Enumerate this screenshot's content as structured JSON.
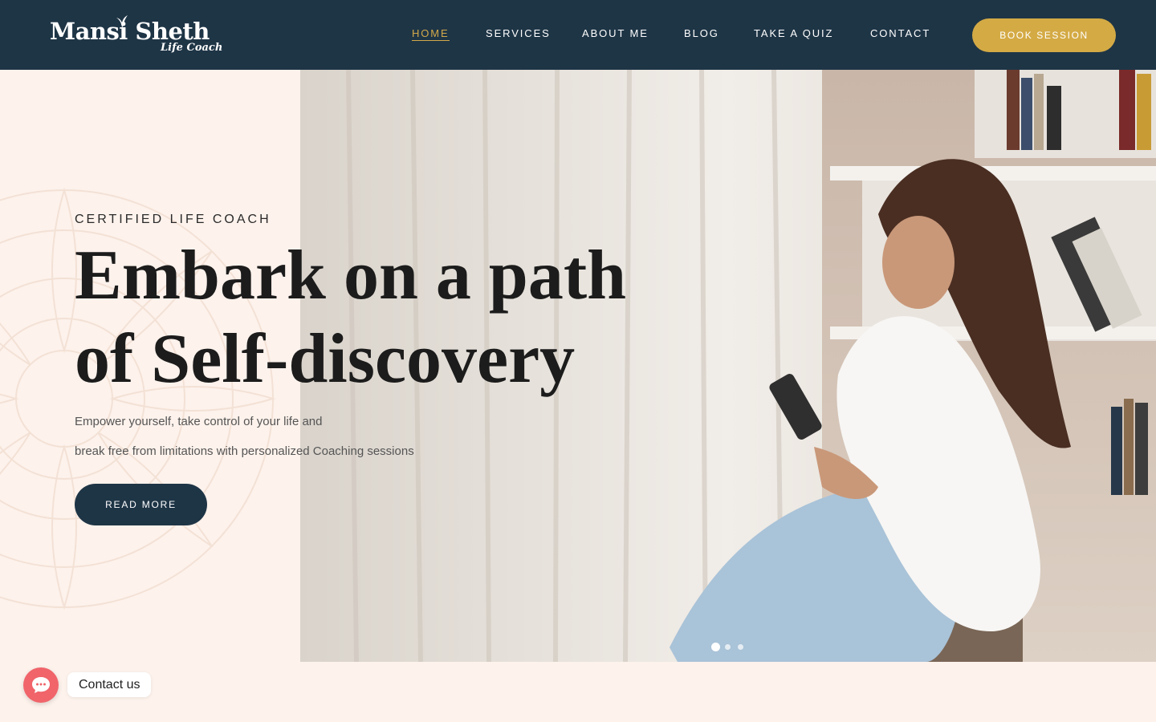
{
  "colors": {
    "navy": "#1e3546",
    "gold": "#d4aa45",
    "cream": "#fdf2ec",
    "chat_red": "#f0646a"
  },
  "logo": {
    "name": "Mansi Sheth",
    "tagline": "Life Coach"
  },
  "nav": {
    "items": [
      {
        "label": "HOME",
        "active": true
      },
      {
        "label": "SERVICES",
        "active": false
      },
      {
        "label": "ABOUT ME",
        "active": false
      },
      {
        "label": "BLOG",
        "active": false
      },
      {
        "label": "TAKE A QUIZ",
        "active": false
      },
      {
        "label": "CONTACT",
        "active": false
      }
    ],
    "cta": "BOOK SESSION"
  },
  "hero": {
    "eyebrow": "CERTIFIED LIFE COACH",
    "headline": "Embark on a path of Self-discovery",
    "subtext_line1": "Empower yourself, take control of your life and",
    "subtext_line2": "break free from limitations with personalized Coaching sessions",
    "button": "READ MORE",
    "slider_dots": 3,
    "active_dot": 1
  },
  "chat": {
    "icon": "chat-bubble-icon",
    "label": "Contact us"
  }
}
